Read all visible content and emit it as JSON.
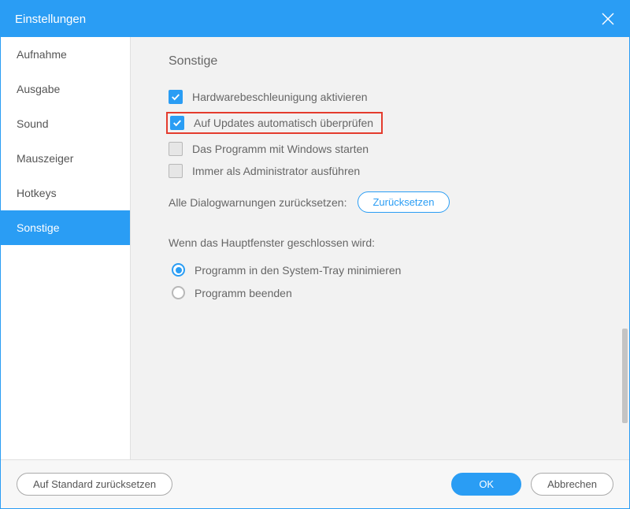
{
  "titlebar": {
    "title": "Einstellungen"
  },
  "sidebar": {
    "items": [
      {
        "label": "Aufnahme"
      },
      {
        "label": "Ausgabe"
      },
      {
        "label": "Sound"
      },
      {
        "label": "Mauszeiger"
      },
      {
        "label": "Hotkeys"
      },
      {
        "label": "Sonstige"
      }
    ],
    "active_index": 5
  },
  "content": {
    "section_title": "Sonstige",
    "options": [
      {
        "label": "Hardwarebeschleunigung aktivieren",
        "checked": true,
        "highlighted": false
      },
      {
        "label": "Auf Updates automatisch überprüfen",
        "checked": true,
        "highlighted": true
      },
      {
        "label": "Das Programm mit Windows starten",
        "checked": false,
        "highlighted": false
      },
      {
        "label": "Immer als Administrator ausführen",
        "checked": false,
        "highlighted": false
      }
    ],
    "reset_dialogs": {
      "label": "Alle Dialogwarnungen zurücksetzen:",
      "button": "Zurücksetzen"
    },
    "close_behavior": {
      "heading": "Wenn das Hauptfenster geschlossen wird:",
      "options": [
        {
          "label": "Programm in den System-Tray minimieren",
          "selected": true
        },
        {
          "label": "Programm beenden",
          "selected": false
        }
      ]
    }
  },
  "footer": {
    "reset_defaults": "Auf Standard zurücksetzen",
    "ok": "OK",
    "cancel": "Abbrechen"
  }
}
